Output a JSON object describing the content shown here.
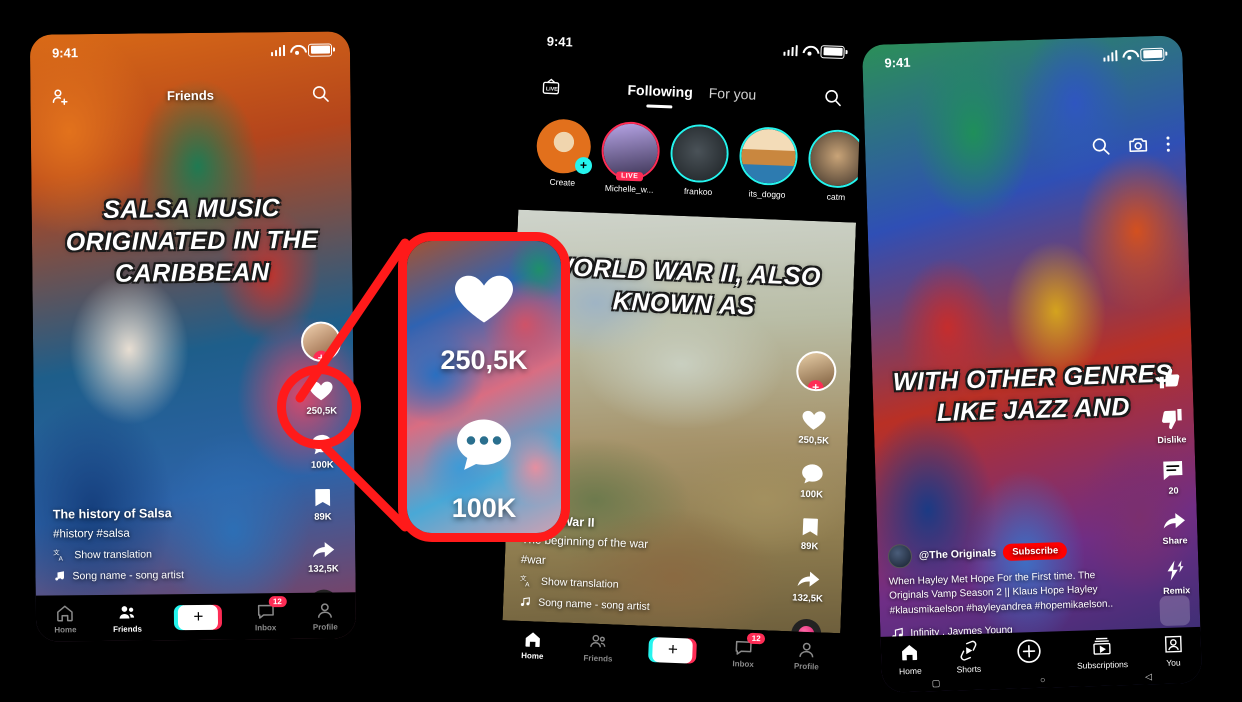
{
  "background_color": "#000000",
  "accent": {
    "tiktok_pink": "#fe2c55",
    "tiktok_cyan": "#25f4ee",
    "youtube_red": "#ff0000",
    "callout_red": "#ff1a1a"
  },
  "phone1": {
    "status": {
      "time": "9:41",
      "signal_icon": "signal-bars-icon",
      "wifi_icon": "wifi-icon",
      "battery_icon": "battery-icon"
    },
    "topbar": {
      "add_friend_icon": "add-person-icon",
      "title": "Friends",
      "search_icon": "search-icon"
    },
    "headline": "SALSA MUSIC ORIGINATED IN THE CARIBBEAN",
    "rail": {
      "avatar_icon": "profile-avatar",
      "follow_label": "+",
      "like_icon": "heart-icon",
      "like_count": "250,5K",
      "comment_icon": "comment-bubble-icon",
      "comment_count": "100K",
      "bookmark_icon": "bookmark-icon",
      "bookmark_count": "89K",
      "share_icon": "share-arrow-icon",
      "share_count": "132,5K",
      "music_disc_icon": "music-disc-icon"
    },
    "caption": {
      "title": "The history of Salsa",
      "hashtags": "#history #salsa",
      "translate_icon": "translate-icon",
      "translate_label": "Show translation",
      "music_icon": "music-note-icon",
      "music_label": "Song name - song artist"
    },
    "tabs": [
      {
        "label": "Home",
        "icon": "home-icon",
        "active": false
      },
      {
        "label": "Friends",
        "icon": "friends-icon",
        "active": true
      },
      {
        "label": "",
        "icon": "plus-create-icon",
        "active": false
      },
      {
        "label": "Inbox",
        "icon": "inbox-icon",
        "badge": "12",
        "active": false
      },
      {
        "label": "Profile",
        "icon": "profile-icon",
        "active": false
      }
    ]
  },
  "phone2": {
    "status": {
      "time": "9:41"
    },
    "header": {
      "live_icon": "live-tv-icon",
      "tab_following": "Following",
      "tab_foryou": "For you",
      "search_icon": "search-icon"
    },
    "stories": [
      {
        "name": "Create",
        "type": "create",
        "ring": "none"
      },
      {
        "name": "Michelle_w...",
        "type": "live",
        "ring": "pinkg",
        "live_label": "LIVE"
      },
      {
        "name": "frankoo",
        "type": "user",
        "ring": "cyan"
      },
      {
        "name": "its_doggo",
        "type": "user",
        "ring": "cyan"
      },
      {
        "name": "catm",
        "type": "user",
        "ring": "cyan"
      }
    ],
    "headline": "WORLD WAR II, ALSO KNOWN AS",
    "rail": {
      "follow_label": "+",
      "like_count": "250,5K",
      "comment_count": "100K",
      "bookmark_count": "89K",
      "share_count": "132,5K"
    },
    "caption": {
      "title": "World War II",
      "subtitle": "The beginning of the war",
      "hashtags": "#war",
      "translate_label": "Show translation",
      "music_label": "Song name - song artist"
    },
    "tabs": [
      {
        "label": "Home",
        "icon": "home-icon",
        "active": true
      },
      {
        "label": "Friends",
        "icon": "friends-icon",
        "active": false
      },
      {
        "label": "",
        "icon": "plus-create-icon",
        "active": false
      },
      {
        "label": "Inbox",
        "icon": "inbox-icon",
        "badge": "12",
        "active": false
      },
      {
        "label": "Profile",
        "icon": "profile-icon",
        "active": false
      }
    ]
  },
  "phone3": {
    "status": {
      "time": "9:41"
    },
    "top_icons": [
      {
        "name": "search-icon"
      },
      {
        "name": "camera-icon"
      },
      {
        "name": "more-vertical-icon"
      }
    ],
    "headline": "WITH OTHER GENRES LIKE JAZZ AND",
    "rail": {
      "like_icon": "thumbs-up-icon",
      "like_label": "",
      "dislike_icon": "thumbs-down-icon",
      "dislike_label": "Dislike",
      "comment_icon": "comment-icon",
      "comment_count": "20",
      "share_icon": "share-icon",
      "share_label": "Share",
      "remix_icon": "remix-icon",
      "remix_label": "Remix"
    },
    "channel": {
      "avatar_icon": "channel-avatar",
      "handle": "@The Originals",
      "subscribe_label": "Subscribe"
    },
    "description": "When Hayley Met Hope For the First time. The Originals Vamp Season 2 || Klaus Hope Hayley #klausmikaelson #hayleyandrea  #hopemikaelson..",
    "music": {
      "icon": "music-note-icon",
      "label": "Infinity . Jaymes Young"
    },
    "thumbnail_icon": "video-thumbnail",
    "tabs": [
      {
        "label": "Home",
        "icon": "home-icon"
      },
      {
        "label": "Shorts",
        "icon": "shorts-icon"
      },
      {
        "label": "",
        "icon": "plus-circle-icon"
      },
      {
        "label": "Subscriptions",
        "icon": "subscriptions-icon"
      },
      {
        "label": "You",
        "icon": "you-avatar-icon"
      }
    ],
    "system_nav": [
      {
        "icon": "square-icon"
      },
      {
        "icon": "circle-icon"
      },
      {
        "icon": "back-triangle-icon"
      }
    ]
  },
  "callout": {
    "like_icon": "heart-icon",
    "like_count": "250,5K",
    "comment_icon": "comment-bubble-icon",
    "comment_count": "100K"
  }
}
